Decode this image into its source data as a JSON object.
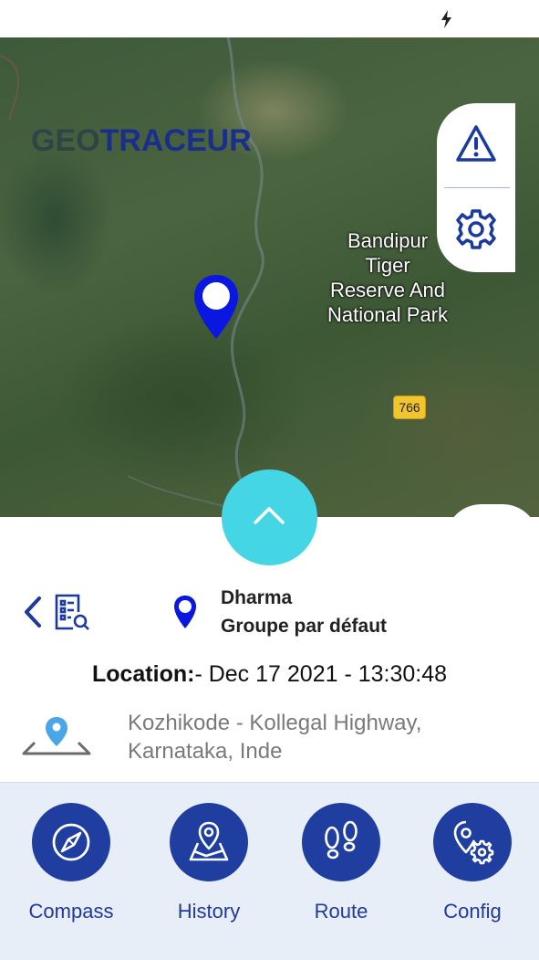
{
  "status_bar": {
    "icon": "charging-bolt-icon"
  },
  "map": {
    "logo_prefix": "GEO",
    "logo_suffix": "TRACEUR",
    "park_label_lines": [
      "Bandipur",
      "Tiger",
      "Reserve And",
      "National Park"
    ],
    "road_number": "766",
    "pin_color": "#0a17e0"
  },
  "side_panel": {
    "alert_icon": "warning-icon",
    "settings_icon": "settings-gear-icon"
  },
  "sheet": {
    "device_name": "Dharma",
    "group_name": "Groupe par défaut",
    "location_label": "Location:",
    "location_value": "- Dec 17 2021 - 13:30:48",
    "address_line1": "Kozhikode - Kollegal Highway,",
    "address_line2": "Karnataka, Inde"
  },
  "nav": {
    "items": [
      {
        "label": "Compass",
        "icon": "compass-icon"
      },
      {
        "label": "History",
        "icon": "map-history-icon"
      },
      {
        "label": "Route",
        "icon": "footsteps-icon"
      },
      {
        "label": "Config",
        "icon": "pin-settings-icon"
      }
    ]
  },
  "colors": {
    "accent": "#44d6e4",
    "nav_circle": "#1f3ea0",
    "nav_background": "#e8eef7",
    "icon_blue": "#1b3a9e"
  }
}
